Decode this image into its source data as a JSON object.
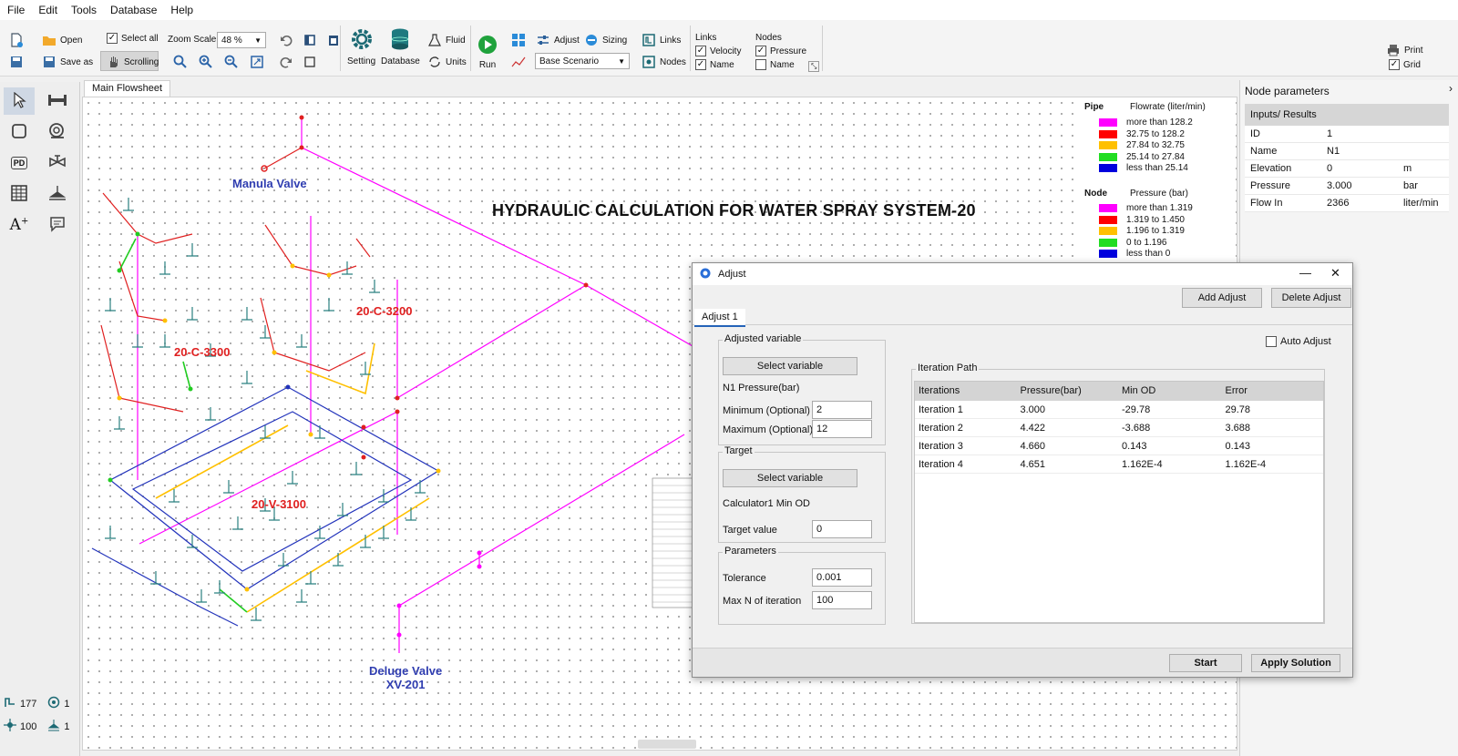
{
  "menu": [
    "File",
    "Edit",
    "Tools",
    "Database",
    "Help"
  ],
  "toolbar": {
    "open": "Open",
    "save_as": "Save as",
    "select_all": "Select all",
    "scrolling": "Scrolling",
    "zoom_scale_label": "Zoom Scale",
    "zoom_value": "48  %",
    "setting": "Setting",
    "database": "Database",
    "fluid": "Fluid",
    "units": "Units",
    "run": "Run",
    "adjust": "Adjust",
    "sizing": "Sizing",
    "scenario": "Base Scenario",
    "links_btn": "Links",
    "nodes_btn": "Nodes",
    "links_group": "Links",
    "links_velocity": "Velocity",
    "links_name": "Name",
    "nodes_group": "Nodes",
    "nodes_pressure": "Pressure",
    "nodes_name": "Name",
    "print": "Print",
    "grid": "Grid"
  },
  "palette_stats": {
    "links_count": "177",
    "links_other": "1",
    "nodes_count": "100",
    "nodes_other": "1"
  },
  "canvas": {
    "tab": "Main Flowsheet",
    "title": "HYDRAULIC CALCULATION FOR WATER SPRAY SYSTEM-20",
    "labels": {
      "manual_valve": "Manula Valve",
      "c3200": "20-C-3200",
      "c3300": "20-C-3300",
      "v3100": "20-V-3100",
      "deluge_line1": "Deluge Valve",
      "deluge_line2": "XV-201"
    }
  },
  "legend": {
    "pipe_title": "Pipe",
    "pipe_unit": "Flowrate (liter/min)",
    "pipe_rows": [
      {
        "color": "#ff00ff",
        "text": "more than 128.2"
      },
      {
        "color": "#ff0000",
        "text": "32.75  to  128.2"
      },
      {
        "color": "#ffc000",
        "text": "27.84  to  32.75"
      },
      {
        "color": "#22dd22",
        "text": "25.14  to  27.84"
      },
      {
        "color": "#0000dd",
        "text": "less than 25.14"
      }
    ],
    "node_title": "Node",
    "node_unit": "Pressure (bar)",
    "node_rows": [
      {
        "color": "#ff00ff",
        "text": "more than 1.319"
      },
      {
        "color": "#ff0000",
        "text": "1.319  to 1.450"
      },
      {
        "color": "#ffc000",
        "text": "1.196  to 1.319"
      },
      {
        "color": "#22dd22",
        "text": "0  to  1.196"
      },
      {
        "color": "#0000dd",
        "text": "less than 0"
      }
    ]
  },
  "node_params": {
    "title": "Node parameters",
    "header": "Inputs/ Results",
    "rows": [
      {
        "name": "ID",
        "value": "1",
        "unit": ""
      },
      {
        "name": "Name",
        "value": "N1",
        "unit": ""
      },
      {
        "name": "Elevation",
        "value": "0",
        "unit": "m"
      },
      {
        "name": "Pressure",
        "value": "3.000",
        "unit": "bar"
      },
      {
        "name": "Flow In",
        "value": "2366",
        "unit": "liter/min"
      }
    ]
  },
  "dialog": {
    "title": "Adjust",
    "add_adjust": "Add Adjust",
    "delete_adjust": "Delete Adjust",
    "tab": "Adjust 1",
    "auto_adjust": "Auto Adjust",
    "adjusted_variable": "Adjusted variable",
    "select_variable": "Select variable",
    "adj_var_text": "N1   Pressure(bar)",
    "minimum_label": "Minimum (Optional)",
    "minimum_value": "2",
    "maximum_label": "Maximum (Optional)",
    "maximum_value": "12",
    "target": "Target",
    "target_select": "Select variable",
    "target_var_text": "Calculator1   Min OD",
    "target_value_label": "Target value",
    "target_value": "0",
    "parameters": "Parameters",
    "tolerance_label": "Tolerance",
    "tolerance_value": "0.001",
    "maxiter_label": "Max N of iteration",
    "maxiter_value": "100",
    "iteration_path": "Iteration Path",
    "columns": [
      "Iterations",
      "Pressure(bar)",
      "Min OD",
      "Error"
    ],
    "rows": [
      [
        "Iteration 1",
        "3.000",
        "-29.78",
        "29.78"
      ],
      [
        "Iteration 2",
        "4.422",
        "-3.688",
        "3.688"
      ],
      [
        "Iteration 3",
        "4.660",
        "0.143",
        "0.143"
      ],
      [
        "Iteration 4",
        "4.651",
        "1.162E-4",
        "1.162E-4"
      ]
    ],
    "start": "Start",
    "apply_solution": "Apply Solution"
  }
}
